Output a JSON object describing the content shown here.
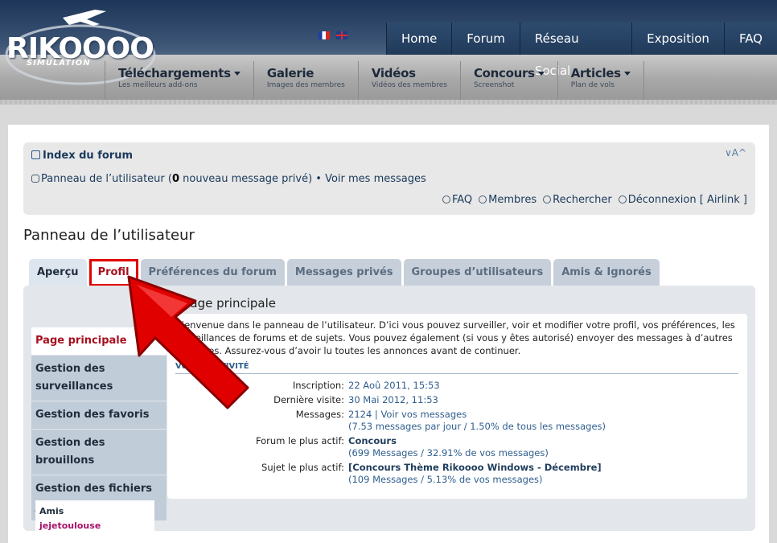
{
  "header": {
    "logo_main": "RIKOOOO",
    "logo_sub": "SIMULATION",
    "topnav": [
      "Home",
      "Forum",
      "Réseau Social",
      "Exposition",
      "FAQ"
    ],
    "subnav": [
      {
        "title": "Téléchargements",
        "sub": "Les meilleurs add-ons",
        "has_arrow": true
      },
      {
        "title": "Galerie",
        "sub": "Images des membres",
        "has_arrow": false
      },
      {
        "title": "Vidéos",
        "sub": "Vidéos des membres",
        "has_arrow": false
      },
      {
        "title": "Concours",
        "sub": "Screenshot",
        "has_arrow": true
      },
      {
        "title": "Articles",
        "sub": "Plan de vols",
        "has_arrow": true
      }
    ]
  },
  "breadcrumb": {
    "index": "Index du forum",
    "font_size": "∨A^"
  },
  "ucp_line": {
    "link": "Panneau de l’utilisateur (",
    "count": "0",
    "rest": " nouveau message privé) • Voir mes messages"
  },
  "quick_links": [
    "FAQ",
    "Membres",
    "Rechercher",
    "Déconnexion [ Airlink ]"
  ],
  "page_title": "Panneau de l’utilisateur",
  "tabs": [
    "Aperçu",
    "Profil",
    "Préférences du forum",
    "Messages privés",
    "Groupes d’utilisateurs",
    "Amis & Ignorés"
  ],
  "sidebar": {
    "items": [
      "Page principale",
      "Gestion des surveillances",
      "Gestion des favoris",
      "Gestion des brouillons",
      "Gestion des fichiers joints"
    ],
    "friends_label": "Amis",
    "friend": "jejetoulouse"
  },
  "main": {
    "title": "Page principale",
    "intro": "Bienvenue dans le panneau de l’utilisateur. D’ici vous pouvez surveiller, voir et modifier votre profil, vos préférences, les surveillances de forums et de sujets. Vous pouvez également (si vous y êtes autorisé) envoyer des messages à d’autres membres. Assurez-vous d’avoir lu toutes les annonces avant de continuer.",
    "activity_head": "VOTRE ACTIVITÉ",
    "stats": [
      {
        "k": "Inscription:",
        "v1": "22 Aoû 2011, 15:53",
        "v2": ""
      },
      {
        "k": "Dernière visite:",
        "v1": "30 Mai 2012, 11:53",
        "v2": ""
      },
      {
        "k": "Messages:",
        "v1": "2124 | Voir vos messages",
        "v2": "(7.53 messages par jour / 1.50% de tous les messages)"
      },
      {
        "k": "Forum le plus actif:",
        "v1": "Concours",
        "v2": "(699 Messages / 32.91% de vos messages)"
      },
      {
        "k": "Sujet le plus actif:",
        "v1": "[Concours Thème Rikoooo Windows - Décembre]",
        "v2": "(109 Messages / 5.13% de vos messages)"
      }
    ]
  },
  "annotation": {
    "color": "#e10000"
  }
}
